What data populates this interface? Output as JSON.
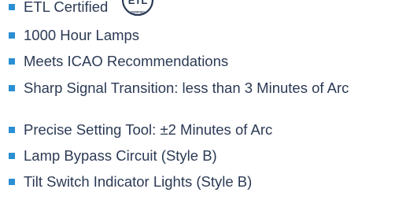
{
  "features": [
    {
      "label": "ETL Certified"
    },
    {
      "label": "1000 Hour Lamps"
    },
    {
      "label": "Meets ICAO Recommendations"
    },
    {
      "label": "Sharp Signal Transition: less than 3 Minutes of Arc"
    },
    {
      "label": "Precise Setting Tool: ±2 Minutes of Arc"
    },
    {
      "label": "Lamp Bypass Circuit (Style B)"
    },
    {
      "label": "Tilt Switch Indicator Lights (Style B)"
    }
  ],
  "etl_logo": {
    "text": "ETL",
    "subtext": "VERIFIED",
    "color": "#2b3a55"
  },
  "colors": {
    "bullet": "#2b8fd4",
    "text": "#2b3a55",
    "background": "#ffffff"
  }
}
